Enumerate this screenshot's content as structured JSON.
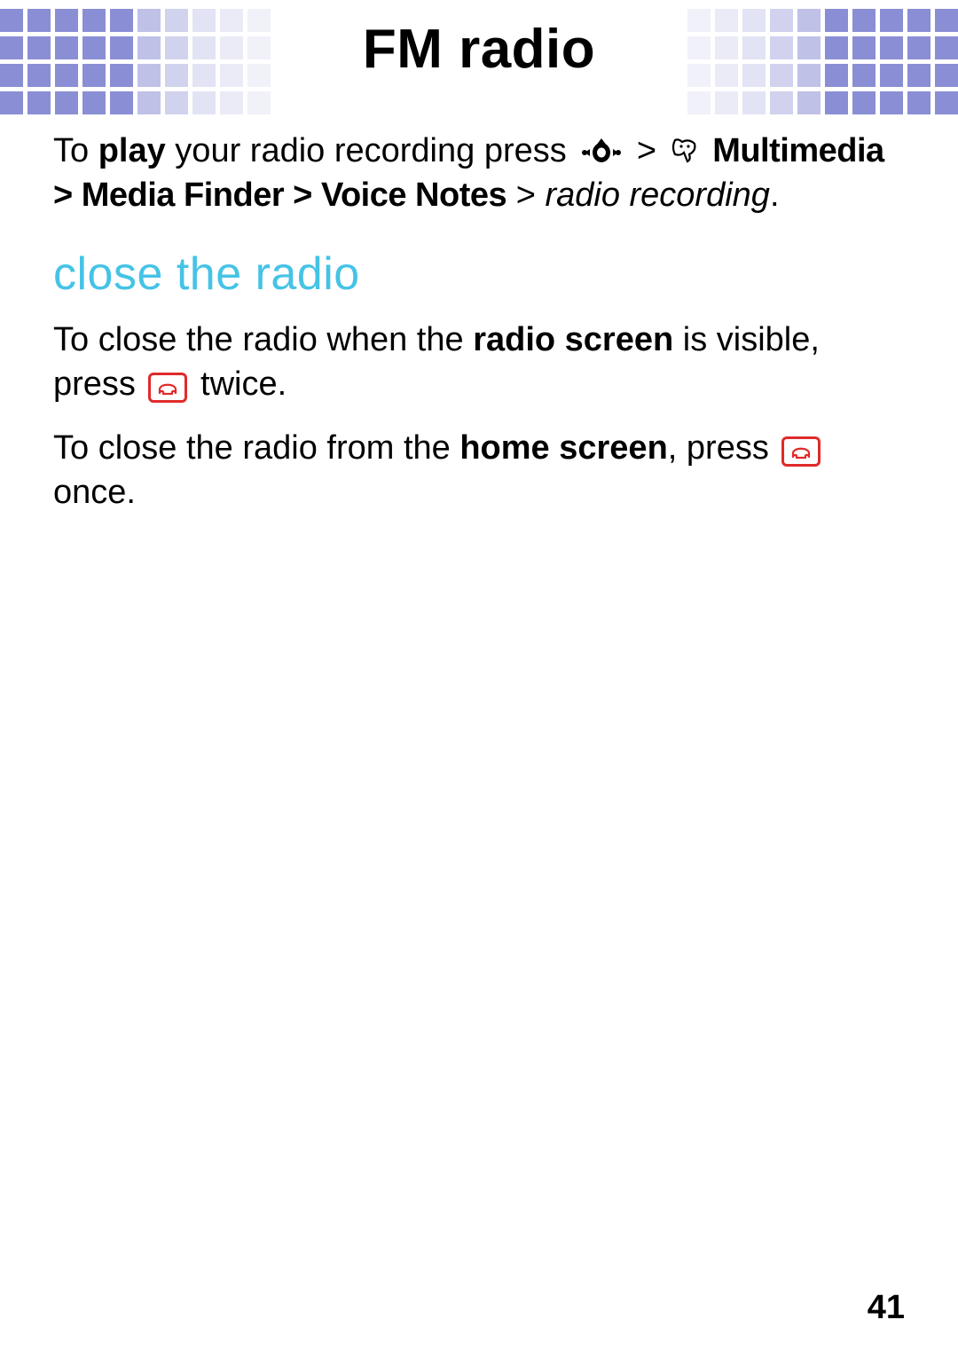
{
  "title": "FM radio",
  "para1": {
    "pre": "To ",
    "play": "play",
    "mid": " your radio recording press ",
    "gt1": " > ",
    "multimedia": "Multimedia",
    "gt2": " > ",
    "media_finder": "Media Finder",
    "gt3": " > ",
    "voice_notes": "Voice Notes",
    "gt4": " > ",
    "radio_recording": "radio recording",
    "end": "."
  },
  "section_heading": "close the radio",
  "para2": {
    "a": "To close the radio when the ",
    "b": "radio screen",
    "c": " is visible, press ",
    "d": " twice."
  },
  "para3": {
    "a": "To close the radio from the ",
    "b": "home screen",
    "c": ", press ",
    "d": " once."
  },
  "page_number": "41"
}
